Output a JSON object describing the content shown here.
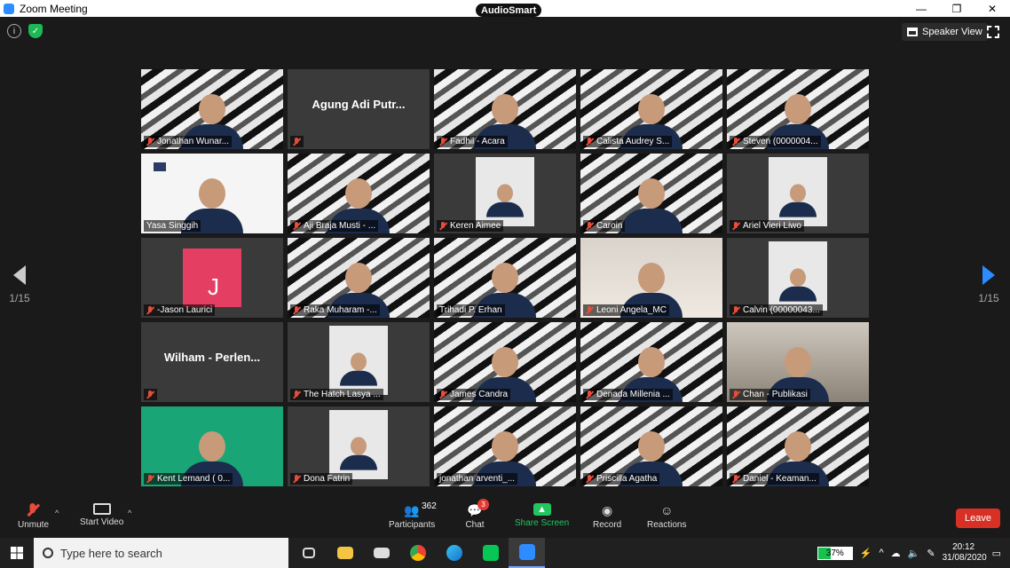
{
  "window": {
    "title": "Zoom Meeting",
    "audiosmart": "AudioSmart",
    "minimize": "—",
    "restore": "❐",
    "close": "✕"
  },
  "top": {
    "speaker_view": "Speaker View"
  },
  "pager": {
    "left": "1/15",
    "right": "1/15"
  },
  "tiles": [
    {
      "name": "Jonathan Wunar...",
      "type": "banner",
      "muted": true
    },
    {
      "name": "",
      "big_name": "Agung Adi Putr...",
      "type": "dark",
      "muted": true
    },
    {
      "name": "Fadhil - Acara",
      "type": "banner",
      "muted": true
    },
    {
      "name": "Calista Audrey S...",
      "type": "banner",
      "muted": true
    },
    {
      "name": "Steven (0000004...",
      "type": "banner",
      "muted": true
    },
    {
      "name": "Yasa Singgih",
      "type": "white",
      "muted": false,
      "active": true
    },
    {
      "name": "Aji Braja Musti - ...",
      "type": "banner",
      "muted": true
    },
    {
      "name": "Keren Aimee",
      "type": "dark",
      "muted": true
    },
    {
      "name": "Caroin",
      "type": "banner",
      "muted": true
    },
    {
      "name": "Ariel Vieri Liwo",
      "type": "dark",
      "muted": true
    },
    {
      "name": "-Jason Laurici",
      "type": "pink",
      "muted": true
    },
    {
      "name": "Raka Muharam -...",
      "type": "banner",
      "muted": true
    },
    {
      "name": "Trihadi P. Erhan",
      "type": "banner",
      "muted": false
    },
    {
      "name": "Leoni Angela_MC",
      "type": "room",
      "muted": true
    },
    {
      "name": "Calvin (00000043...",
      "type": "dark",
      "muted": true
    },
    {
      "name": "",
      "big_name": "Wilham - Perlen...",
      "type": "dark",
      "muted": true
    },
    {
      "name": "The Hatch Lasya ...",
      "type": "dark",
      "muted": true
    },
    {
      "name": "James Candra",
      "type": "banner",
      "muted": true
    },
    {
      "name": "Denada Millenia ...",
      "type": "banner",
      "muted": true
    },
    {
      "name": "Chan - Publikasi",
      "type": "lightroom",
      "muted": true
    },
    {
      "name": "Kent Lemand ( 0...",
      "type": "green",
      "muted": true
    },
    {
      "name": "Dona Fatrin",
      "type": "dark",
      "muted": true
    },
    {
      "name": "jonathan arventi_...",
      "type": "banner",
      "muted": false
    },
    {
      "name": "Priscilla Agatha",
      "type": "banner",
      "muted": true
    },
    {
      "name": "Daniel - Keaman...",
      "type": "banner",
      "muted": true
    }
  ],
  "toolbar": {
    "unmute": "Unmute",
    "start_video": "Start Video",
    "participants": "Participants",
    "participants_count": "362",
    "chat": "Chat",
    "chat_badge": "3",
    "share_screen": "Share Screen",
    "record": "Record",
    "reactions": "Reactions",
    "leave": "Leave"
  },
  "taskbar": {
    "search_placeholder": "Type here to search",
    "battery": "37%",
    "time": "20:12",
    "date": "31/08/2020"
  },
  "colors": {
    "accent": "#2d8cff",
    "leave": "#d93025",
    "share": "#22c55e",
    "active_border": "#d6e85a"
  }
}
